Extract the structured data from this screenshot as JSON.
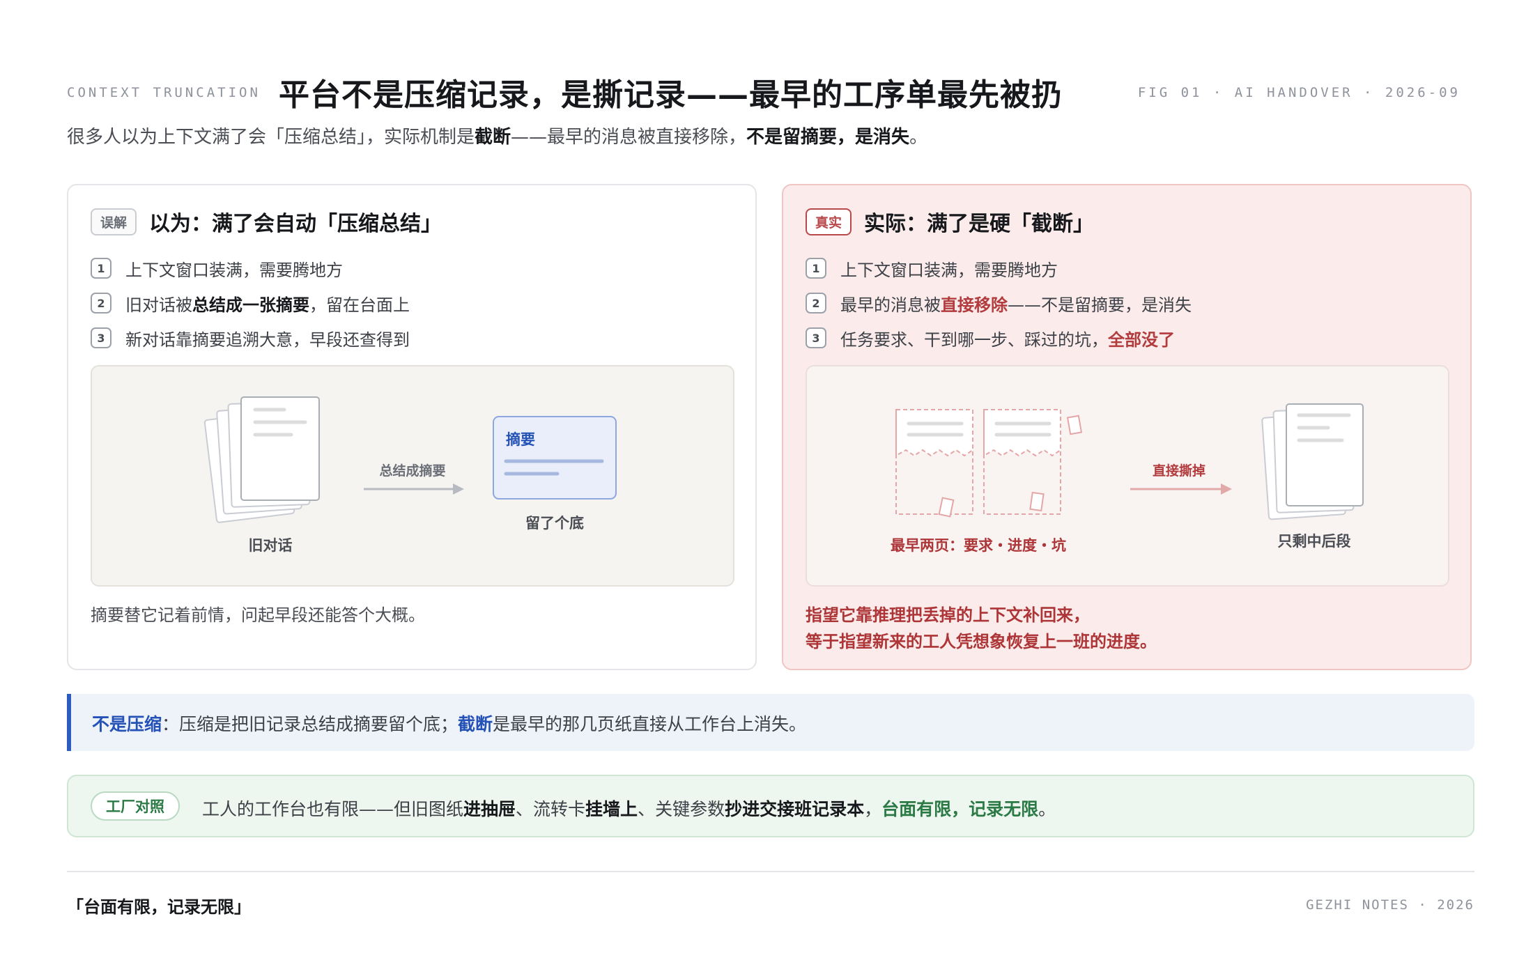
{
  "header": {
    "kicker": "CONTEXT TRUNCATION",
    "title": "平台不是压缩记录，是撕记录——最早的工序单最先被扔",
    "fig_code": "FIG 01 · AI HANDOVER · 2026-09"
  },
  "subtitle": {
    "part1": "很多人以为上下文满了会「压缩总结」，实际机制是",
    "bold1": "截断",
    "part2": "——最早的消息被直接移除，",
    "bold2": "不是留摘要，是消失",
    "part3": "。"
  },
  "left_panel": {
    "tag": "误解",
    "title": "以为：满了会自动「压缩总结」",
    "steps": [
      {
        "num": "1",
        "text": "上下文窗口装满，需要腾地方"
      },
      {
        "num": "2",
        "pre": "旧对话被",
        "bold": "总结成一张摘要",
        "post": "，留在台面上"
      },
      {
        "num": "3",
        "text": "新对话靠摘要追溯大意，早段还查得到"
      }
    ],
    "illustration": {
      "stack_label": "旧对话",
      "arrow_label": "总结成摘要",
      "card_title": "摘要",
      "card_label": "留了个底"
    },
    "note": "摘要替它记着前情，问起早段还能答个大概。"
  },
  "right_panel": {
    "tag": "真实",
    "title": "实际：满了是硬「截断」",
    "steps": [
      {
        "num": "1",
        "text": "上下文窗口装满，需要腾地方"
      },
      {
        "num": "2",
        "pre": "最早的消息被",
        "bold": "直接移除",
        "post": "——不是留摘要，是消失"
      },
      {
        "num": "3",
        "pre": "任务要求、干到哪一步、踩过的坑，",
        "bold": "全部没了",
        "post": ""
      }
    ],
    "illustration": {
      "torn_label": "最早两页：要求・进度・坑",
      "arrow_label": "直接撕掉",
      "stack_label": "只剩中后段"
    },
    "note_line1": "指望它靠推理把丢掉的上下文补回来，",
    "note_line2": "等于指望新来的工人凭想象恢复上一班的进度。"
  },
  "callout": {
    "bold1": "不是压缩",
    "part1": "：压缩是把旧记录总结成摘要留个底；",
    "bold2": "截断",
    "part2": "是最早的那几页纸直接从工作台上消失。"
  },
  "factory": {
    "tag": "工厂对照",
    "part1": "工人的工作台也有限——但旧图纸",
    "bold1": "进抽屉",
    "part2": "、流转卡",
    "bold2": "挂墙上",
    "part3": "、关键参数",
    "bold3": "抄进交接班记录本",
    "part4": "，",
    "green": "台面有限，记录无限",
    "part5": "。"
  },
  "footer": {
    "motto": "「台面有限，记录无限」",
    "brand": "GEZHI NOTES · 2026"
  },
  "colors": {
    "accent_red": "#b23b3d",
    "accent_blue": "#2552b6",
    "accent_green": "#2b7a45"
  }
}
